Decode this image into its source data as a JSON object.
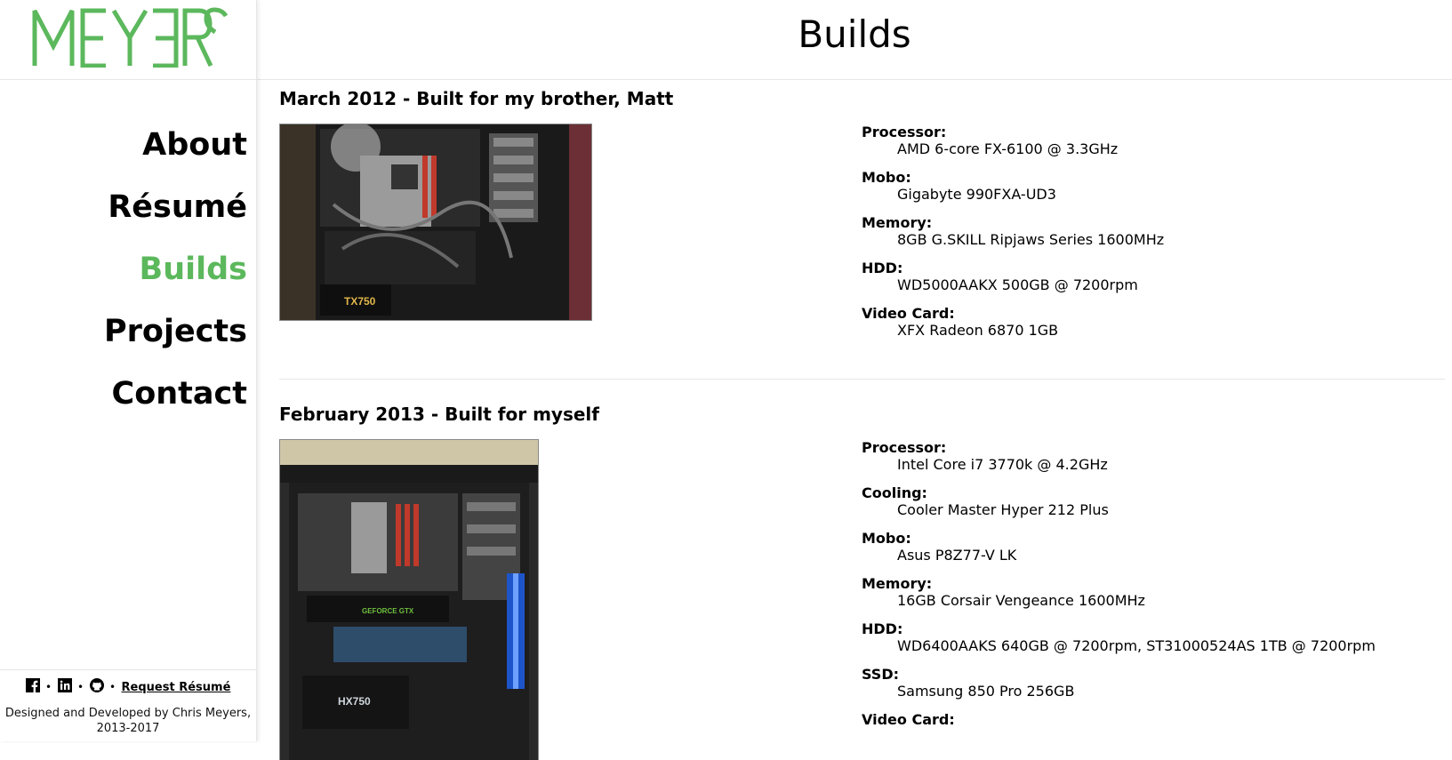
{
  "brand": {
    "logo_text": "MEYƎRS",
    "accent_color": "#5cb85c"
  },
  "nav": {
    "items": [
      {
        "label": "About",
        "active": false
      },
      {
        "label": "Résumé",
        "active": false
      },
      {
        "label": "Builds",
        "active": true
      },
      {
        "label": "Projects",
        "active": false
      },
      {
        "label": "Contact",
        "active": false
      }
    ]
  },
  "footer": {
    "icons": [
      "facebook-icon",
      "linkedin-icon",
      "github-icon"
    ],
    "separator": "•",
    "request_resume_label": "Request Résumé",
    "credit_line1": "Designed and Developed by Chris Meyers,",
    "credit_line2": "2013-2017"
  },
  "header": {
    "title": "Builds"
  },
  "builds": [
    {
      "title": "March 2012 - Built for my brother, Matt",
      "psu_label": "TX750",
      "specs": [
        {
          "label": "Processor:",
          "value": "AMD 6-core FX-6100 @ 3.3GHz"
        },
        {
          "label": "Mobo:",
          "value": "Gigabyte 990FXA-UD3"
        },
        {
          "label": "Memory:",
          "value": "8GB G.SKILL Ripjaws Series 1600MHz"
        },
        {
          "label": "HDD:",
          "value": "WD5000AAKX 500GB @ 7200rpm"
        },
        {
          "label": "Video Card:",
          "value": "XFX Radeon 6870 1GB"
        }
      ]
    },
    {
      "title": "February 2013 - Built for myself",
      "psu_label": "HX750",
      "gpu_label": "GEFORCE GTX",
      "specs": [
        {
          "label": "Processor:",
          "value": "Intel Core i7 3770k @ 4.2GHz"
        },
        {
          "label": "Cooling:",
          "value": "Cooler Master Hyper 212 Plus"
        },
        {
          "label": "Mobo:",
          "value": "Asus P8Z77-V LK"
        },
        {
          "label": "Memory:",
          "value": "16GB Corsair Vengeance 1600MHz"
        },
        {
          "label": "HDD:",
          "value": "WD6400AAKS 640GB @ 7200rpm, ST31000524AS 1TB @ 7200rpm"
        },
        {
          "label": "SSD:",
          "value": "Samsung 850 Pro 256GB"
        },
        {
          "label": "Video Card:",
          "value": ""
        }
      ]
    }
  ]
}
